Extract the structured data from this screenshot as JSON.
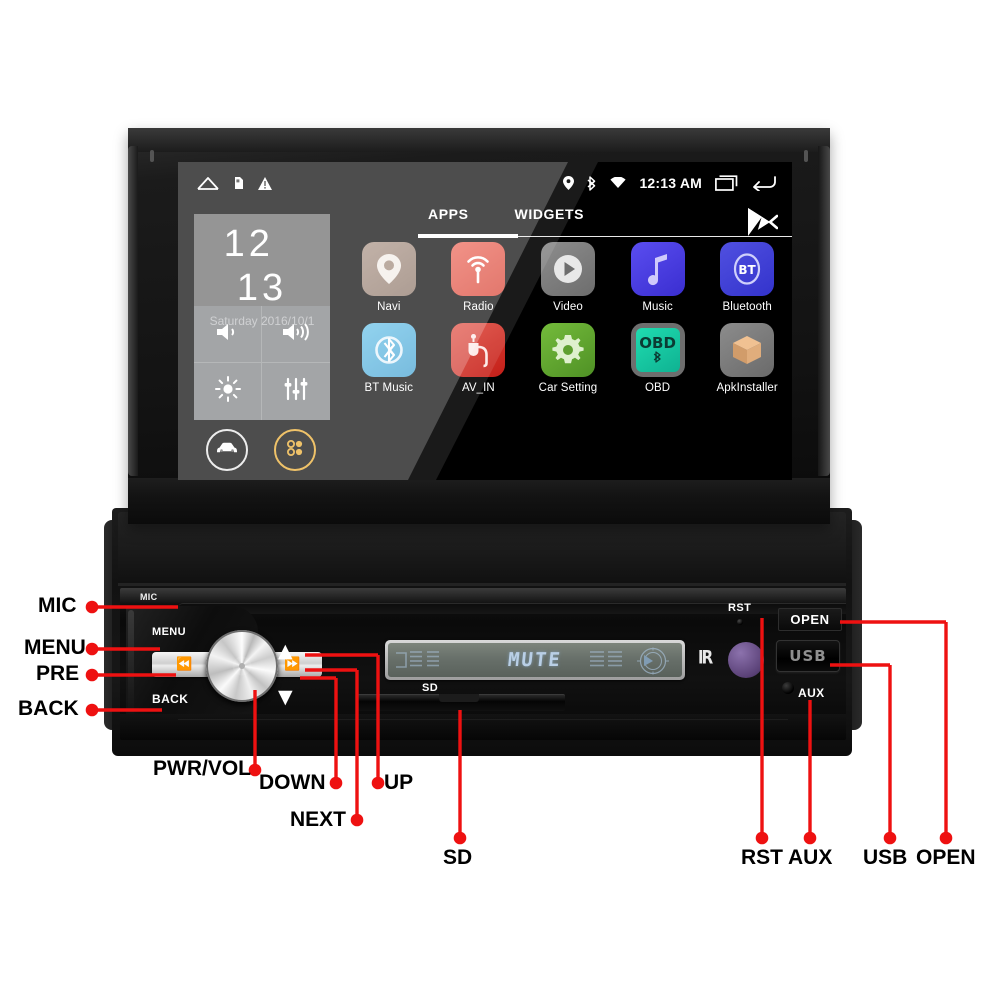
{
  "device": {
    "type": "single-din-car-stereo",
    "screen_os": "android-launcher"
  },
  "screen": {
    "statusbar": {
      "left_icons": [
        "home-icon",
        "sim-card-icon",
        "warning-icon"
      ],
      "right_icons": [
        "location-icon",
        "bluetooth-icon",
        "wifi-icon"
      ],
      "time": "12:13 AM",
      "recents_icon": "recents-icon",
      "back_icon": "back-icon"
    },
    "tabs": [
      {
        "label": "APPS",
        "active": true
      },
      {
        "label": "WIDGETS",
        "active": false
      }
    ],
    "play_store_icon": "play-store-icon",
    "widget": {
      "hour": "12",
      "minute": "13",
      "date": "Saturday 2016/10/1",
      "quick_tiles": [
        {
          "name": "volume-down-tile",
          "icon": "speaker-low-icon"
        },
        {
          "name": "volume-up-tile",
          "icon": "speaker-high-icon"
        },
        {
          "name": "brightness-tile",
          "icon": "brightness-icon"
        },
        {
          "name": "equalizer-tile",
          "icon": "equalizer-icon"
        }
      ],
      "dock": [
        {
          "name": "car-mode-button",
          "icon": "car-icon",
          "accent": "#e6e6e6"
        },
        {
          "name": "all-apps-button",
          "icon": "apps-grid-icon",
          "accent": "#e8a829"
        }
      ]
    },
    "apps": [
      {
        "label": "Navi",
        "icon": "map-pin-icon",
        "bg": "#9c8678"
      },
      {
        "label": "Radio",
        "icon": "radio-waves-icon",
        "bg": "#e04b3c"
      },
      {
        "label": "Video",
        "icon": "play-circle-icon",
        "bg": "#808080"
      },
      {
        "label": "Music",
        "icon": "music-note-icon",
        "bg": "#4b3fe0"
      },
      {
        "label": "Bluetooth",
        "icon": "bluetooth-bt-icon",
        "bg": "#3f3fd6"
      },
      {
        "label": "BT Music",
        "icon": "bt-headphone-icon",
        "bg": "#52b4e0"
      },
      {
        "label": "AV_IN",
        "icon": "av-plug-icon",
        "bg": "#d62a22"
      },
      {
        "label": "Car Setting",
        "icon": "gear-icon",
        "bg": "#63a832"
      },
      {
        "label": "OBD",
        "icon": "obd-icon",
        "bg": "#16c9a0"
      },
      {
        "label": "ApkInstaller",
        "icon": "package-box-icon",
        "bg": "#7e7e7e"
      }
    ]
  },
  "faceplate": {
    "mic_label": "MIC",
    "menu_label": "MENU",
    "back_label": "BACK",
    "pre_glyph": "prev-track-icon",
    "next_glyph": "next-track-icon",
    "up_glyph": "chevron-up-icon",
    "down_glyph": "chevron-down-icon",
    "lcd_text": "MUTE",
    "ir_label": "IR",
    "sd_label": "SD",
    "rst_label": "RST",
    "open_label": "OPEN",
    "usb_label": "USB",
    "aux_label": "AUX"
  },
  "callouts": {
    "left": [
      {
        "label": "MIC",
        "key": "mic"
      },
      {
        "label": "MENU",
        "key": "menu"
      },
      {
        "label": "PRE",
        "key": "pre"
      },
      {
        "label": "BACK",
        "key": "back"
      }
    ],
    "bottom": [
      {
        "label": "PWR/VOL",
        "key": "pwr-vol"
      },
      {
        "label": "DOWN",
        "key": "down"
      },
      {
        "label": "NEXT",
        "key": "next"
      },
      {
        "label": "UP",
        "key": "up"
      },
      {
        "label": "SD",
        "key": "sd"
      }
    ],
    "right": [
      {
        "label": "RST",
        "key": "rst"
      },
      {
        "label": "AUX",
        "key": "aux"
      },
      {
        "label": "USB",
        "key": "usb"
      },
      {
        "label": "OPEN",
        "key": "open"
      }
    ],
    "line_color": "#ee1111"
  }
}
